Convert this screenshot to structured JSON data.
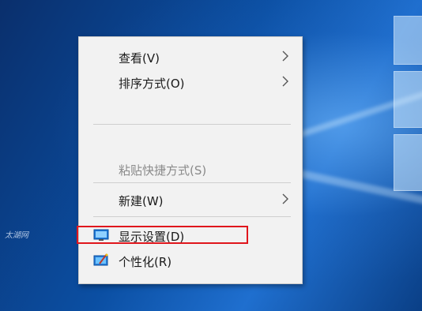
{
  "watermark": "太湖网",
  "menu": {
    "items": [
      {
        "label": "查看(V)",
        "submenu": true,
        "enabled": true
      },
      {
        "label": "排序方式(O)",
        "submenu": true,
        "enabled": true
      },
      {
        "label": "粘贴快捷方式(S)",
        "submenu": false,
        "enabled": false
      },
      {
        "label": "新建(W)",
        "submenu": true,
        "enabled": true
      },
      {
        "label": "显示设置(D)",
        "submenu": false,
        "enabled": true,
        "icon": "display-settings-icon",
        "highlighted": true
      },
      {
        "label": "个性化(R)",
        "submenu": false,
        "enabled": true,
        "icon": "personalize-icon"
      }
    ]
  },
  "colors": {
    "highlight_border": "#e0161c",
    "menu_bg": "#f2f2f2",
    "desktop_blue": "#0b4fa3"
  }
}
